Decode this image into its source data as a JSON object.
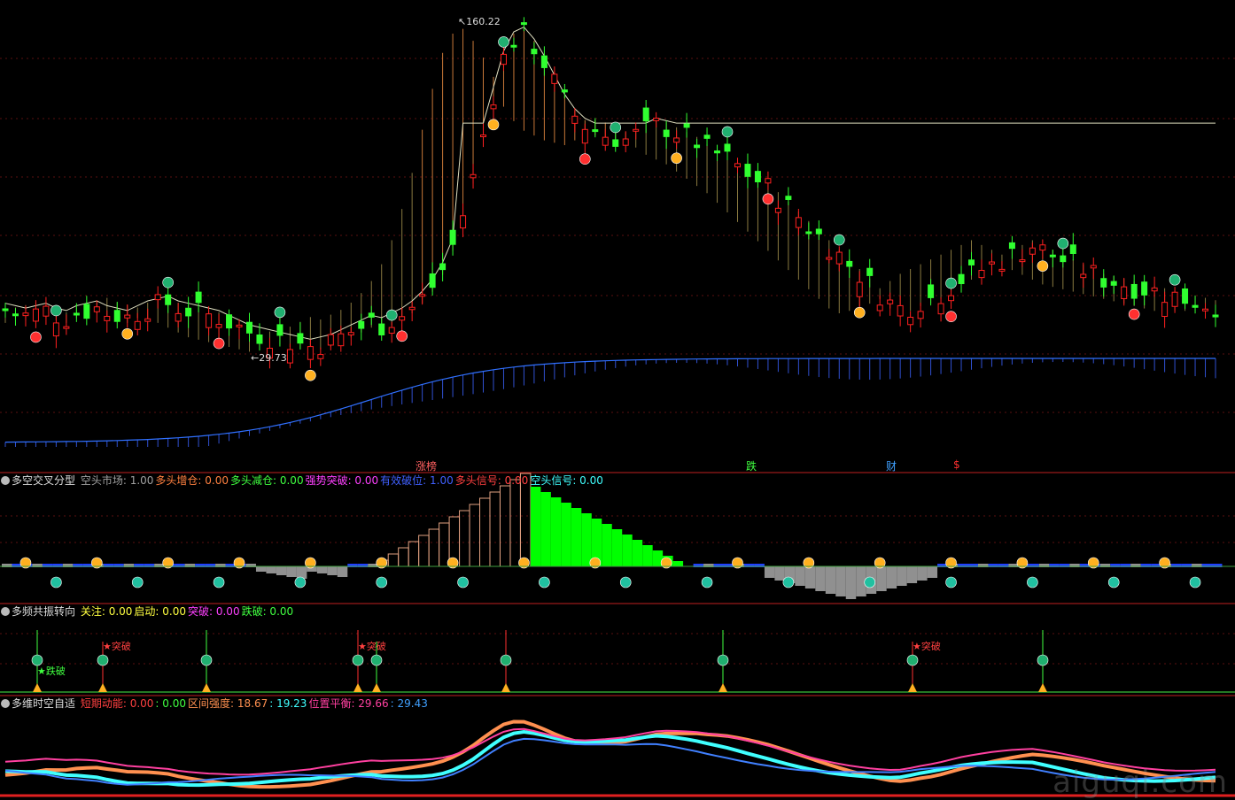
{
  "chart_data": [
    {
      "type": "candlestick",
      "panel": "main",
      "price_high_label": "160.22",
      "price_low_label": "29.73",
      "event_labels": [
        {
          "text": "涨榜",
          "color": "#ff6060"
        },
        {
          "text": "跌",
          "color": "#40ff40"
        },
        {
          "text": "财",
          "color": "#40a0ff"
        },
        {
          "text": "$",
          "color": "#ff3030"
        }
      ],
      "trend": [
        45,
        44,
        43,
        44,
        45,
        43,
        42,
        44,
        45,
        46,
        44,
        43,
        42,
        44,
        46,
        47,
        48,
        46,
        45,
        44,
        43,
        42,
        40,
        38,
        36,
        35,
        34,
        33,
        32,
        31,
        30,
        31,
        32,
        34,
        36,
        38,
        40,
        39,
        41,
        43,
        46,
        50,
        55,
        62,
        72,
        85,
        100,
        118,
        135,
        150,
        158,
        160,
        155,
        148,
        140,
        132,
        126,
        122,
        120,
        118,
        117,
        116,
        118,
        120,
        122,
        121,
        119,
        117,
        115,
        112,
        110,
        108,
        105,
        102,
        99,
        96,
        92,
        88,
        84,
        80,
        76,
        72,
        68,
        64,
        60,
        56,
        52,
        48,
        46,
        47,
        49,
        50,
        52,
        55,
        58,
        60,
        62,
        64,
        66,
        68,
        70,
        72,
        70,
        68,
        66,
        64,
        62,
        60,
        58,
        57,
        56,
        55,
        54,
        53,
        52,
        51,
        50,
        49,
        48,
        47
      ]
    },
    {
      "type": "area",
      "panel": "多空交叉分型",
      "title": "多空交叉分型",
      "indicators": [
        {
          "label": "空头市场:",
          "value": "1.00",
          "color": "#a0a0a0"
        },
        {
          "label": "多头增仓:",
          "value": "0.00",
          "color": "#ff8040"
        },
        {
          "label": "多头减仓:",
          "value": "0.00",
          "color": "#40ff40"
        },
        {
          "label": "强势突破:",
          "value": "0.00",
          "color": "#ff40ff"
        },
        {
          "label": "有效破位:",
          "value": "1.00",
          "color": "#4060ff"
        },
        {
          "label": "多头信号:",
          "value": "0.00",
          "color": "#ff4040"
        },
        {
          "label": "空头信号:",
          "value": "0.00",
          "color": "#40ffff"
        }
      ]
    },
    {
      "type": "signal",
      "panel": "多频共振转向",
      "title": "多频共振转向",
      "indicators": [
        {
          "label": "关注:",
          "value": "0.00",
          "color": "#ffff40"
        },
        {
          "label": "启动:",
          "value": "0.00",
          "color": "#ffff40"
        },
        {
          "label": "突破:",
          "value": "0.00",
          "color": "#ff40ff"
        },
        {
          "label": "跌破:",
          "value": "0.00",
          "color": "#40ff40"
        }
      ],
      "signal_labels": [
        {
          "text": "★跌破",
          "color": "#40ff40"
        },
        {
          "text": "★突破",
          "color": "#ff4040"
        },
        {
          "text": "★突破",
          "color": "#ff4040"
        },
        {
          "text": "★突破",
          "color": "#ff4040"
        }
      ]
    },
    {
      "type": "line",
      "panel": "多维时空自适",
      "title": "多维时空自适",
      "indicators": [
        {
          "label": "短期动能:",
          "value": "0.00",
          "color": "#ff4040"
        },
        {
          "label": ":",
          "value": "0.00",
          "color": "#40ff40"
        },
        {
          "label": "区间强度:",
          "value": "18.67",
          "color": "#ff9050"
        },
        {
          "label": ":",
          "value": "19.23",
          "color": "#40ffff"
        },
        {
          "label": "位置平衡:",
          "value": "29.66",
          "color": "#ff40a0"
        },
        {
          "label": ":",
          "value": "29.43",
          "color": "#40a0ff"
        }
      ]
    }
  ],
  "watermark": "aiguqi.com"
}
